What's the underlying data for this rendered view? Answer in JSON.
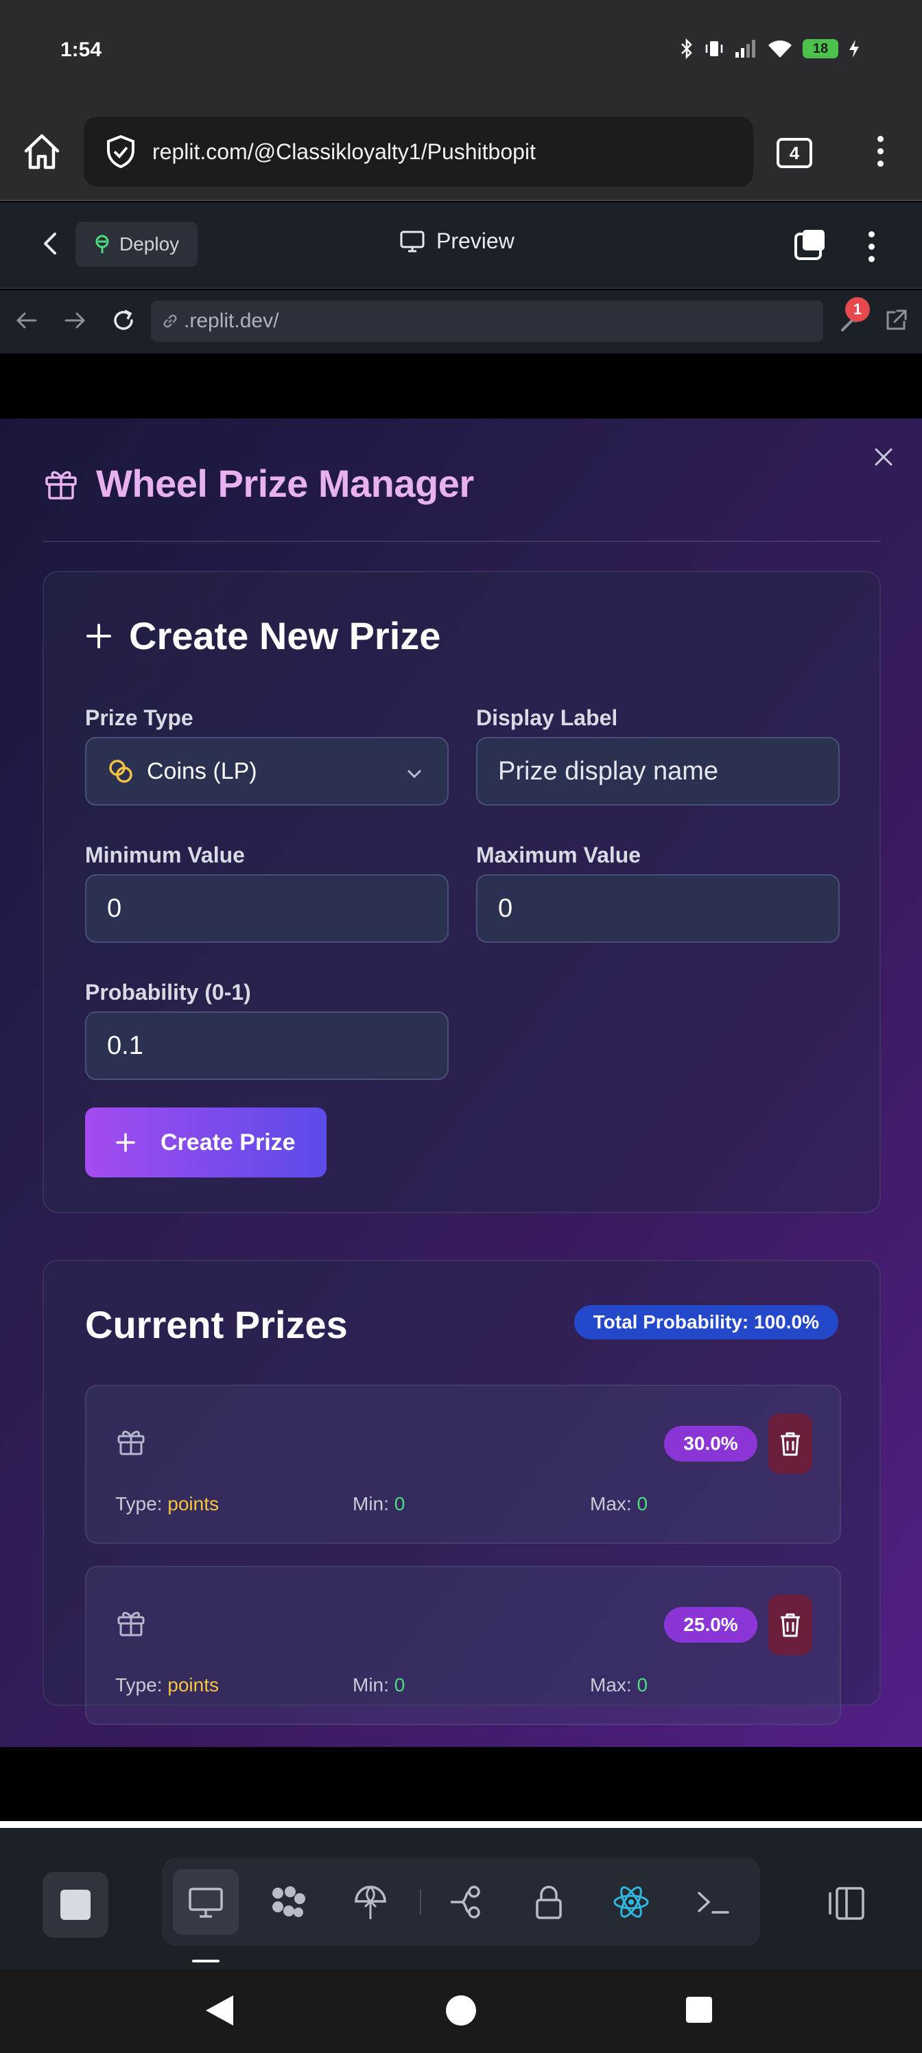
{
  "status": {
    "time": "1:54",
    "battery": "18"
  },
  "browser": {
    "url": "replit.com/@Classikloyalty1/Pushitbopit",
    "tab_count": "4"
  },
  "replit": {
    "deploy_label": "Deploy",
    "preview_label": "Preview",
    "nav_url": ".replit.dev/",
    "devtools_badge": "1"
  },
  "modal": {
    "title": "Wheel Prize Manager",
    "create": {
      "title": "Create New Prize",
      "prize_type_label": "Prize Type",
      "prize_type_value": "Coins (LP)",
      "display_label_label": "Display Label",
      "display_label_placeholder": "Prize display name",
      "min_label": "Minimum Value",
      "min_value": "0",
      "max_label": "Maximum Value",
      "max_value": "0",
      "probability_label": "Probability (0-1)",
      "probability_value": "0.1",
      "button_label": "Create Prize"
    },
    "prizes": {
      "title": "Current Prizes",
      "total_probability": "Total Probability: 100.0%",
      "type_label": "Type:",
      "min_label": "Min:",
      "max_label": "Max:",
      "items": [
        {
          "probability": "30.0%",
          "type": "points",
          "min": "0",
          "max": "0"
        },
        {
          "probability": "25.0%",
          "type": "points",
          "min": "0",
          "max": "0"
        }
      ]
    }
  },
  "colors": {
    "accent_purple": "#a44bf0",
    "accent_blue": "#5b4be8",
    "title_pink": "#e7b2ef",
    "badge_blue": "#2348c9",
    "badge_purple": "#8b35d6",
    "type_yellow": "#f5c542",
    "value_green": "#4ade80"
  },
  "icons": {
    "header": "gift-icon",
    "create": "plus-icon",
    "prize_type": "coins-icon",
    "delete": "trash-icon",
    "close": "close-icon"
  }
}
